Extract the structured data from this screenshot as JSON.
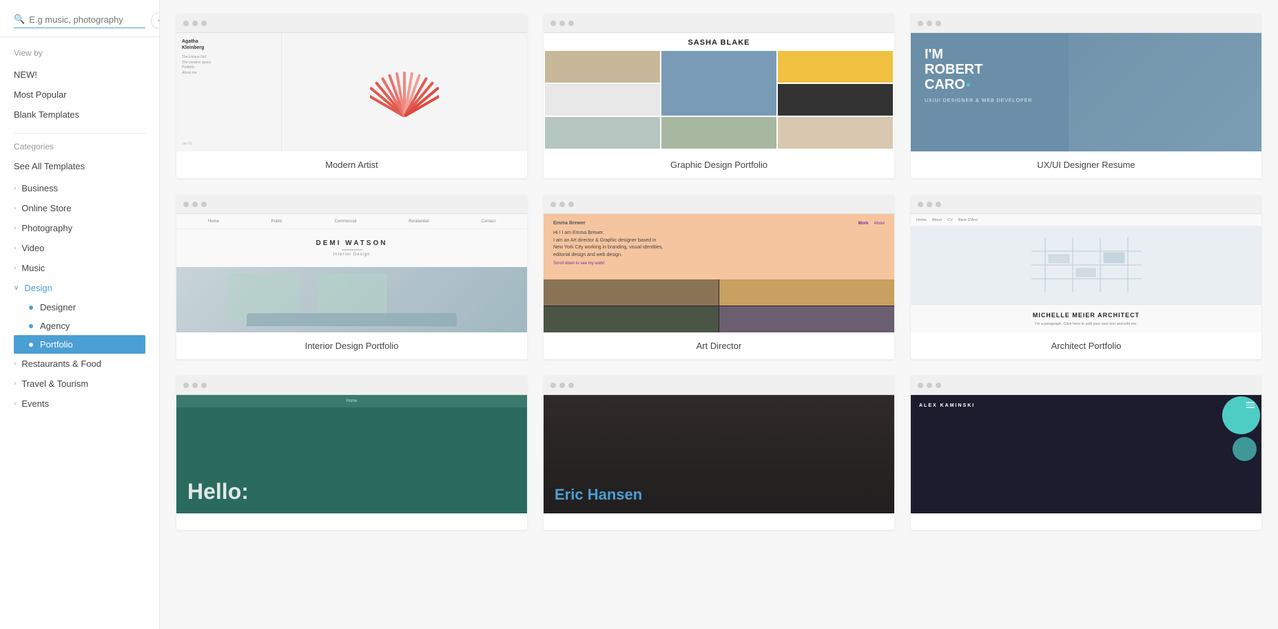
{
  "sidebar": {
    "collapse_icon": "‹",
    "search": {
      "placeholder": "E.g music, photography",
      "icon": "🔍"
    },
    "view_by_label": "View by",
    "nav_items": [
      {
        "id": "new",
        "label": "NEW!"
      },
      {
        "id": "most-popular",
        "label": "Most Popular"
      },
      {
        "id": "blank-templates",
        "label": "Blank Templates"
      }
    ],
    "categories_label": "Categories",
    "see_all_label": "See All Templates",
    "categories": [
      {
        "id": "business",
        "label": "Business",
        "expanded": false
      },
      {
        "id": "online-store",
        "label": "Online Store",
        "expanded": false
      },
      {
        "id": "photography",
        "label": "Photography",
        "expanded": false
      },
      {
        "id": "video",
        "label": "Video",
        "expanded": false
      },
      {
        "id": "music",
        "label": "Music",
        "expanded": false
      },
      {
        "id": "design",
        "label": "Design",
        "expanded": true,
        "subcategories": [
          {
            "id": "designer",
            "label": "Designer",
            "active": false
          },
          {
            "id": "agency",
            "label": "Agency",
            "active": false
          },
          {
            "id": "portfolio",
            "label": "Portfolio",
            "active": true
          }
        ]
      },
      {
        "id": "restaurants-food",
        "label": "Restaurants & Food",
        "expanded": false
      },
      {
        "id": "travel-tourism",
        "label": "Travel & Tourism",
        "expanded": false
      },
      {
        "id": "events",
        "label": "Events",
        "expanded": false
      }
    ]
  },
  "templates": {
    "row1": [
      {
        "id": "modern-artist",
        "title": "Modern Artist",
        "preview_type": "modern-artist"
      },
      {
        "id": "graphic-design-portfolio",
        "title": "Graphic Design Portfolio",
        "preview_type": "graphic-design"
      },
      {
        "id": "ux-ui-designer-resume",
        "title": "UX/UI Designer Resume",
        "preview_type": "ux-designer"
      }
    ],
    "row2": [
      {
        "id": "interior-design-portfolio",
        "title": "Interior Design Portfolio",
        "preview_type": "interior"
      },
      {
        "id": "art-director",
        "title": "Art Director",
        "preview_type": "art-director"
      },
      {
        "id": "architect-portfolio",
        "title": "Architect Portfolio",
        "preview_type": "architect"
      }
    ],
    "row3": [
      {
        "id": "hello-template",
        "title": "",
        "preview_type": "hello"
      },
      {
        "id": "eric-hansen",
        "title": "",
        "preview_type": "eric"
      },
      {
        "id": "alex-kaminski",
        "title": "",
        "preview_type": "alex"
      }
    ]
  },
  "preview_texts": {
    "modern_artist_name": "Agatha\nKleinberg",
    "sasha_blake": "SASHA BLAKE",
    "robert_name": "I'M\nROBERT\nCARO.",
    "robert_sub": "UX/UI DESIGNER & WEB\nDEVELOPER",
    "demi_watson": "DEMI\nWATSON",
    "demi_sub": "Interior Design",
    "emma_name": "Emma Brewer",
    "emma_text": "Hi I I am Emma Brewer.\nI am an Art director & Graphic designer based in\nNew York City working in branding, visual identities,\neditorial design and web design.",
    "emma_scroll": "Scroll down to see my work!",
    "michelle_name": "MICHELLE MEIER ARCHITECT",
    "michelle_sub": "I'm a paragraph. Click here to add your own text and edit me.",
    "hello_text": "Hello:",
    "eric_text": "Eric Hansen",
    "alex_name": "ALEX KAMINSKI"
  }
}
